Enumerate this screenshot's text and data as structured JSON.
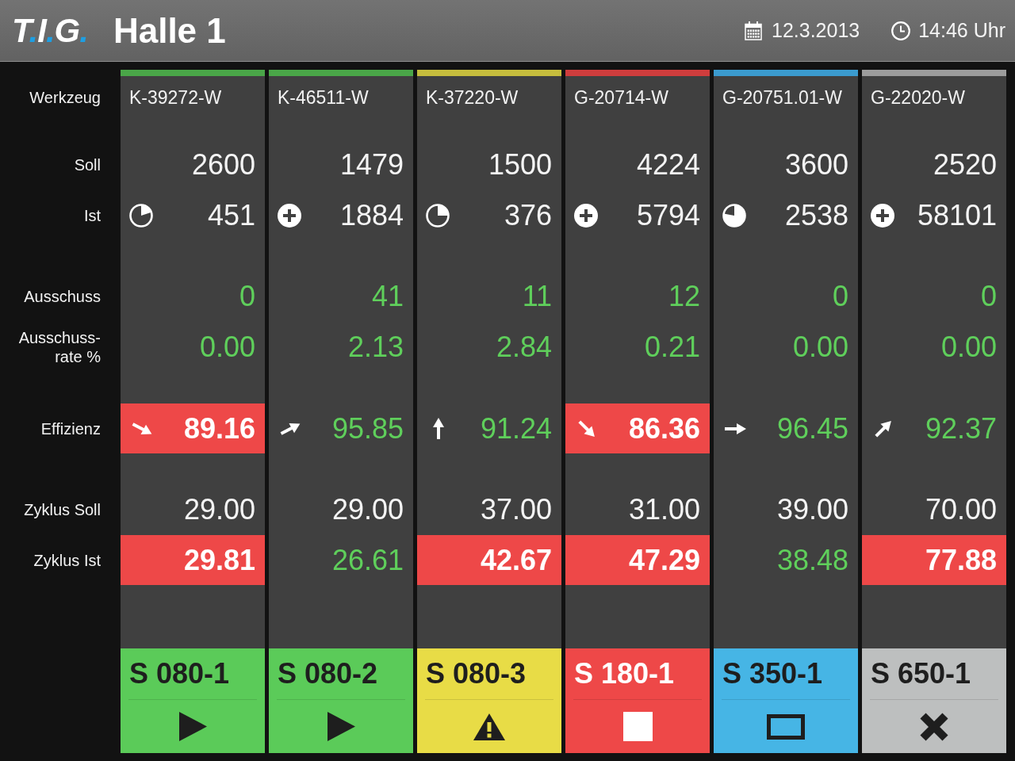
{
  "header": {
    "logo": [
      {
        "text": "T",
        "kind": "letter"
      },
      {
        "text": ".",
        "kind": "dot"
      },
      {
        "text": "I",
        "kind": "letter"
      },
      {
        "text": ".",
        "kind": "dot"
      },
      {
        "text": "G",
        "kind": "letter"
      },
      {
        "text": ".",
        "kind": "dot"
      }
    ],
    "title": "Halle 1",
    "date": "12.3.2013",
    "time": "14:46 Uhr"
  },
  "row_labels": [
    "Werkzeug",
    "Soll",
    "Ist",
    "Ausschuss",
    "Ausschuss-rate %",
    "Effizienz",
    "Zyklus Soll",
    "Zyklus Ist"
  ],
  "machines": [
    {
      "tool": "K-39272-W",
      "target": "2600",
      "actual": "451",
      "actual_icon": {
        "kind": "pie-fifth"
      },
      "rejects": "0",
      "reject_rate": "0.00",
      "efficiency": {
        "value": "89.16",
        "kind": "dipping",
        "alert": true
      },
      "cycle_target": "29.00",
      "cycle_actual": {
        "value": "29.81",
        "alert": true
      },
      "station": {
        "label": "S 080-1",
        "kind": "running"
      }
    },
    {
      "tool": "K-46511-W",
      "target": "1479",
      "actual": "1884",
      "actual_icon": {
        "kind": "plus"
      },
      "rejects": "41",
      "reject_rate": "2.13",
      "efficiency": {
        "value": "95.85",
        "kind": "climbing",
        "alert": false
      },
      "cycle_target": "29.00",
      "cycle_actual": {
        "value": "26.61",
        "alert": false
      },
      "station": {
        "label": "S 080-2",
        "kind": "running"
      }
    },
    {
      "tool": "K-37220-W",
      "target": "1500",
      "actual": "376",
      "actual_icon": {
        "kind": "pie-quarter"
      },
      "rejects": "11",
      "reject_rate": "2.84",
      "efficiency": {
        "value": "91.24",
        "kind": "up",
        "alert": false
      },
      "cycle_target": "37.00",
      "cycle_actual": {
        "value": "42.67",
        "alert": true
      },
      "station": {
        "label": "S 080-3",
        "kind": "warning"
      }
    },
    {
      "tool": "G-20714-W",
      "target": "4224",
      "actual": "5794",
      "actual_icon": {
        "kind": "plus"
      },
      "rejects": "12",
      "reject_rate": "0.21",
      "efficiency": {
        "value": "86.36",
        "kind": "falling",
        "alert": true
      },
      "cycle_target": "31.00",
      "cycle_actual": {
        "value": "47.29",
        "alert": true
      },
      "station": {
        "label": "S 180-1",
        "kind": "stopped"
      }
    },
    {
      "tool": "G-20751.01-W",
      "target": "3600",
      "actual": "2538",
      "actual_icon": {
        "kind": "pie-three-quarters"
      },
      "rejects": "0",
      "reject_rate": "0.00",
      "efficiency": {
        "value": "96.45",
        "kind": "flat",
        "alert": false
      },
      "cycle_target": "39.00",
      "cycle_actual": {
        "value": "38.48",
        "alert": false
      },
      "station": {
        "label": "S 350-1",
        "kind": "idle"
      }
    },
    {
      "tool": "G-22020-W",
      "target": "2520",
      "actual": "58101",
      "actual_icon": {
        "kind": "plus"
      },
      "rejects": "0",
      "reject_rate": "0.00",
      "efficiency": {
        "value": "92.37",
        "kind": "rising",
        "alert": false
      },
      "cycle_target": "70.00",
      "cycle_actual": {
        "value": "77.88",
        "alert": true
      },
      "station": {
        "label": "S 650-1",
        "kind": "off"
      }
    }
  ]
}
